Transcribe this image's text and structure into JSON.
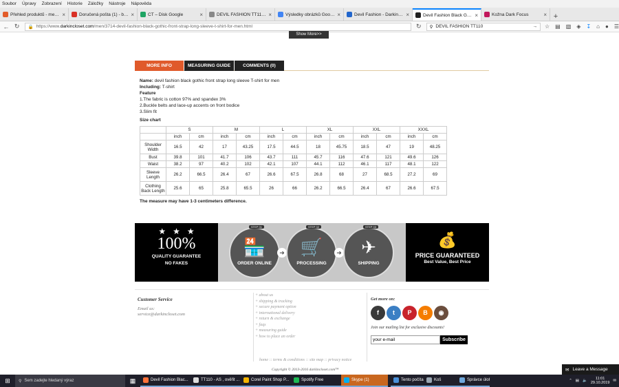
{
  "menubar": [
    "Soubor",
    "Úpravy",
    "Zobrazení",
    "Historie",
    "Záložky",
    "Nástroje",
    "Nápověda"
  ],
  "tabs": [
    {
      "label": "Přehled produktů - metals...",
      "color": "#e25c2a",
      "active": false
    },
    {
      "label": "Doručená pošta (1) - bogd...",
      "color": "#d93025",
      "active": false
    },
    {
      "label": "CT – Disk Google",
      "color": "#1fa463",
      "active": false
    },
    {
      "label": "DEVIL FASHION TT110 - Hl...",
      "color": "#888888",
      "active": false
    },
    {
      "label": "Výsledky obrázků Google ...",
      "color": "#4285f4",
      "active": false
    },
    {
      "label": "Devil Fashion - DarkinClos...",
      "color": "#2266cc",
      "active": false
    },
    {
      "label": "Devil Fashion Black Gothic...",
      "color": "#222222",
      "active": true
    },
    {
      "label": "Kožnа Dark Focus",
      "color": "#c2185b",
      "active": false
    }
  ],
  "nav": {
    "url_prefix": "https://www.",
    "url_domain": "darkincloset.com",
    "url_path": "/men/3714-devil-fashion-black-gothic-front-strap-long-sleeve-t-shirt-for-men.html",
    "search_value": "DEVIL FASHION TT110"
  },
  "page": {
    "show_more": "Show More>>",
    "tabs": [
      "MORE INFO",
      "MEASURING GUIDE",
      "COMMENTS (0)"
    ],
    "name_label": "Name:",
    "name_value": " devil fashion black gothic front strap long sleeve T-shirt for men",
    "including_label": "Including:",
    "including_value": " T-shirt",
    "feature_label": "Feature",
    "features": [
      "1.The fabric is cotton 97% and spandex 3%",
      "2.Buckle belts and lace-up accents on front bodice",
      "3.Slim fit"
    ],
    "size_chart_label": "Size chart",
    "note": "The measure may have 1-3 centimeters difference."
  },
  "size_table": {
    "sizes": [
      "S",
      "M",
      "L",
      "XL",
      "XXL",
      "XXXL"
    ],
    "units": [
      "inch",
      "cm",
      "inch",
      "cm",
      "inch",
      "cm",
      "inch",
      "cm",
      "inch",
      "cm",
      "inch",
      "cm"
    ],
    "rows": [
      {
        "label": "Shoulder Width",
        "values": [
          "16.5",
          "42",
          "17",
          "43.25",
          "17.5",
          "44.5",
          "18",
          "45.75",
          "18.5",
          "47",
          "19",
          "48.25"
        ]
      },
      {
        "label": "Bust",
        "values": [
          "39.8",
          "101",
          "41.7",
          "106",
          "43.7",
          "111",
          "45.7",
          "116",
          "47.6",
          "121",
          "49.6",
          "126"
        ]
      },
      {
        "label": "Waist",
        "values": [
          "38.2",
          "97",
          "40.2",
          "102",
          "42.1",
          "107",
          "44.1",
          "112",
          "46.1",
          "117",
          "48.1",
          "122"
        ]
      },
      {
        "label": "Sleeve Length",
        "values": [
          "26.2",
          "66.5",
          "26.4",
          "67",
          "26.6",
          "67.5",
          "26.8",
          "68",
          "27",
          "68.5",
          "27.2",
          "69"
        ]
      },
      {
        "label": "Clothing Back Length",
        "values": [
          "25.6",
          "65",
          "25.8",
          "65.5",
          "26",
          "66",
          "26.2",
          "66.5",
          "26.4",
          "67",
          "26.6",
          "67.5"
        ]
      }
    ]
  },
  "banner": {
    "percent": "100%",
    "quality": "QUALITY GUARANTEE",
    "nofakes": "NO FAKES",
    "steps": [
      {
        "badge": "STEP 01",
        "label": "ORDER ONLINE",
        "icon": "shop-icon"
      },
      {
        "badge": "STEP 02",
        "label": "PROCESSING",
        "icon": "trolley-icon"
      },
      {
        "badge": "STEP 03",
        "label": "SHIPPING",
        "icon": "plane-icon"
      }
    ],
    "price_title": "PRICE GUARANTEED",
    "price_sub": "Best Value, Best Price"
  },
  "footer": {
    "cs_title": "Customer Service",
    "email_label": "Email us:",
    "email": "service@darkincloset.com",
    "links": [
      "+ about us",
      "+ shipping & tracking",
      "+ secure payment option",
      "+ international delivery",
      "+ return & exchange",
      "+ faqs",
      "+ measuring guide",
      "+ how to place an order"
    ],
    "get_more": "Get more on:",
    "mailing": "Join our mailing list for exclusive discounts!",
    "email_placeholder": "your e-mail",
    "subscribe": "Subscribe",
    "bottom_links": "home :: terms & conditions :: site map :: privacy notice",
    "copyright": "Copyright © 2013-2016 darkincloset.com™"
  },
  "chat": {
    "label": "Leave a Message"
  },
  "taskbar": {
    "search_placeholder": "Sem zadejte hledaný výraz",
    "items": [
      {
        "label": "Devil Fashion Blac...",
        "color": "#ff7139"
      },
      {
        "label": "TT110 - AS , ověřit ...",
        "color": "#dddddd"
      },
      {
        "label": "Corel Paint Shop P...",
        "color": "#f4b400"
      },
      {
        "label": "Spotify Free",
        "color": "#1db954"
      },
      {
        "label": "Skype (1)",
        "color": "#00aff0"
      },
      {
        "label": "Tento počítač",
        "color": "#4a90d9"
      },
      {
        "label": "Koš",
        "color": "#9aa6b2"
      },
      {
        "label": "Správce úloh",
        "color": "#6fa8dc"
      }
    ],
    "time": "11:01",
    "date": "29.10.2019"
  },
  "colors": {
    "accent": "#e05a2b",
    "dark": "#222222"
  }
}
